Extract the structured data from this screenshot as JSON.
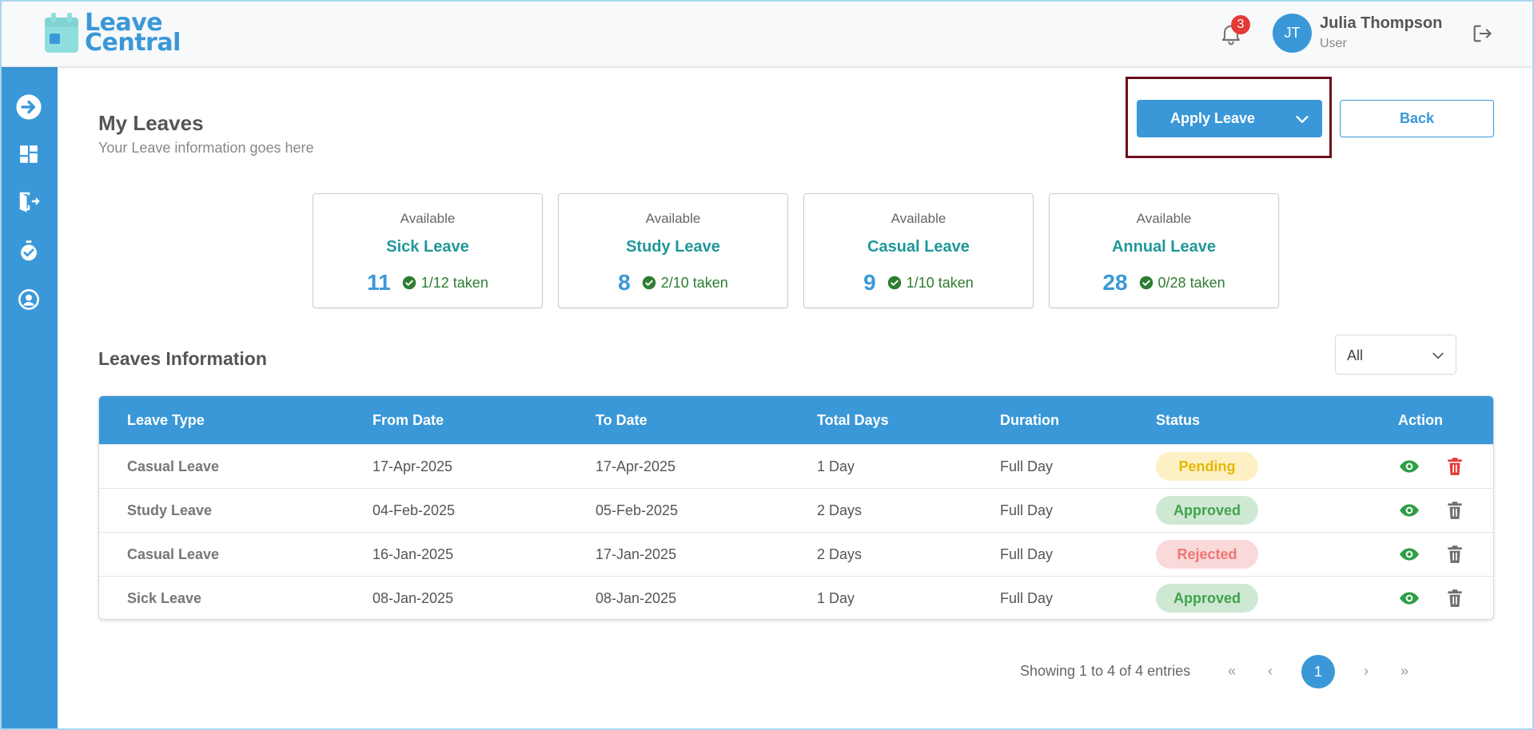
{
  "app": {
    "logo_line1": "Leave",
    "logo_line2": "Central"
  },
  "header": {
    "notification_count": "3",
    "avatar_initials": "JT",
    "user_name": "Julia Thompson",
    "user_role": "User"
  },
  "sidebar": {
    "icons": [
      "arrow-right-circle-icon",
      "dashboard-icon",
      "leave-exit-icon",
      "timer-icon",
      "account-circle-icon"
    ]
  },
  "page": {
    "title": "My Leaves",
    "subtitle": "Your Leave information goes here",
    "apply_label": "Apply Leave",
    "back_label": "Back"
  },
  "balances": [
    {
      "available": "Available",
      "type": "Sick Leave",
      "count": "11",
      "taken": "1/12 taken"
    },
    {
      "available": "Available",
      "type": "Study Leave",
      "count": "8",
      "taken": "2/10 taken"
    },
    {
      "available": "Available",
      "type": "Casual Leave",
      "count": "9",
      "taken": "1/10 taken"
    },
    {
      "available": "Available",
      "type": "Annual Leave",
      "count": "28",
      "taken": "0/28 taken"
    }
  ],
  "leaves": {
    "section_title": "Leaves Information",
    "filter_value": "All",
    "columns": [
      "Leave Type",
      "From Date",
      "To Date",
      "Total Days",
      "Duration",
      "Status",
      "Action"
    ],
    "rows": [
      {
        "type": "Casual Leave",
        "from": "17-Apr-2025",
        "to": "17-Apr-2025",
        "days": "1 Day",
        "duration": "Full Day",
        "status": "Pending"
      },
      {
        "type": "Study Leave",
        "from": "04-Feb-2025",
        "to": "05-Feb-2025",
        "days": "2 Days",
        "duration": "Full Day",
        "status": "Approved"
      },
      {
        "type": "Casual Leave",
        "from": "16-Jan-2025",
        "to": "17-Jan-2025",
        "days": "2 Days",
        "duration": "Full Day",
        "status": "Rejected"
      },
      {
        "type": "Sick Leave",
        "from": "08-Jan-2025",
        "to": "08-Jan-2025",
        "days": "1 Day",
        "duration": "Full Day",
        "status": "Approved"
      }
    ]
  },
  "pagination": {
    "summary": "Showing 1 to 4 of 4 entries",
    "first": "«",
    "prev": "‹",
    "current": "1",
    "next": "›",
    "last": "»"
  },
  "colors": {
    "primary": "#3a98d8",
    "teal": "#20979a",
    "highlight": "#6b0f1a",
    "delete_red": "#e53935"
  }
}
